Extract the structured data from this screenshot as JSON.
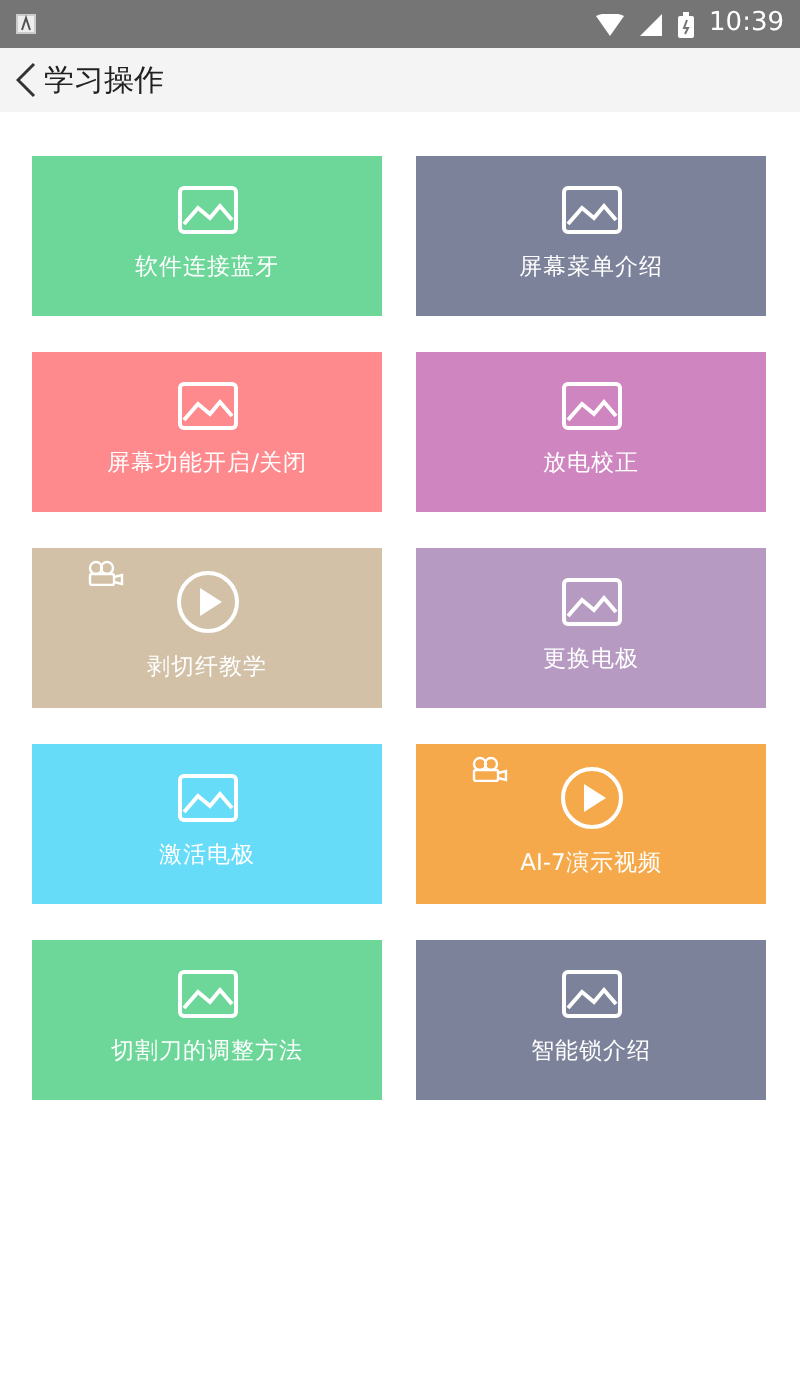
{
  "status_bar": {
    "time": "10:39"
  },
  "header": {
    "title": "学习操作"
  },
  "tiles": [
    {
      "label": "软件连接蓝牙",
      "kind": "image",
      "color": "#6dd79a"
    },
    {
      "label": "屏幕菜单介绍",
      "kind": "image",
      "color": "#7c8299"
    },
    {
      "label": "屏幕功能开启/关闭",
      "kind": "image",
      "color": "#fe8a8e"
    },
    {
      "label": "放电校正",
      "kind": "image",
      "color": "#cf86c0"
    },
    {
      "label": "剥切纤教学",
      "kind": "video",
      "color": "#d2c1a6"
    },
    {
      "label": "更换电极",
      "kind": "image",
      "color": "#b79ac1"
    },
    {
      "label": "激活电极",
      "kind": "image",
      "color": "#66dcf8"
    },
    {
      "label": "AI-7演示视频",
      "kind": "video",
      "color": "#f5a94a"
    },
    {
      "label": "切割刀的调整方法",
      "kind": "image",
      "color": "#6dd79a"
    },
    {
      "label": "智能锁介绍",
      "kind": "image",
      "color": "#7c8299"
    }
  ]
}
